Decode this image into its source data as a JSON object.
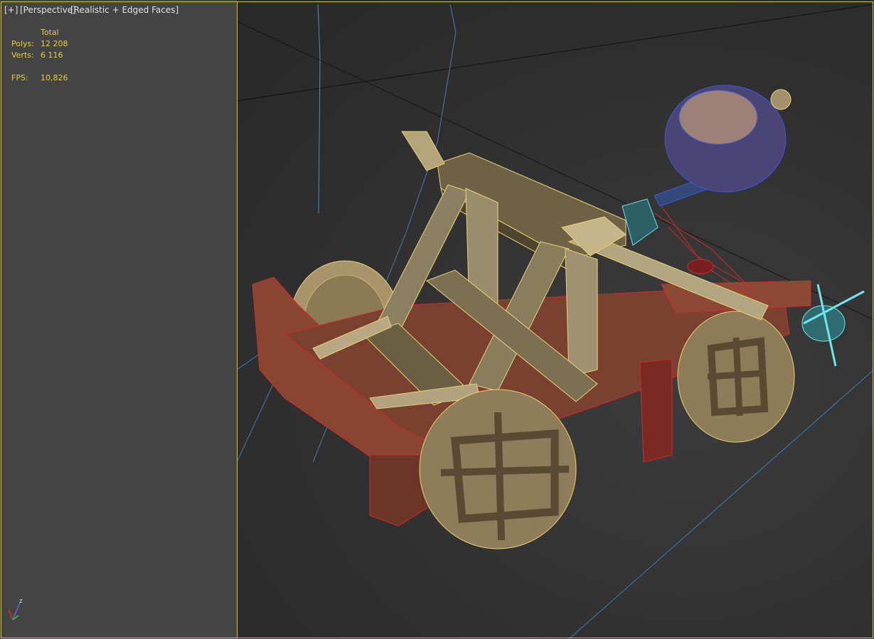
{
  "viewport": {
    "menu_label": "[+]",
    "view_label": "[Perspective]",
    "shading_label": "[Realistic + Edged Faces]"
  },
  "stats": {
    "header": "Total",
    "polys_label": "Polys:",
    "polys_value": "12 208",
    "verts_label": "Verts:",
    "verts_value": "6 116",
    "fps_label": "FPS:",
    "fps_value": "10,826"
  },
  "axis_gizmo": {
    "z_label": "z"
  },
  "colors": {
    "frame": "#d9c22f",
    "stats_text": "#e6cf3a",
    "wire_yellow": "#e8d27a",
    "wire_red": "#d22b2b",
    "wire_cyan": "#6fe7ea",
    "wire_blue": "#3a5bd6"
  }
}
